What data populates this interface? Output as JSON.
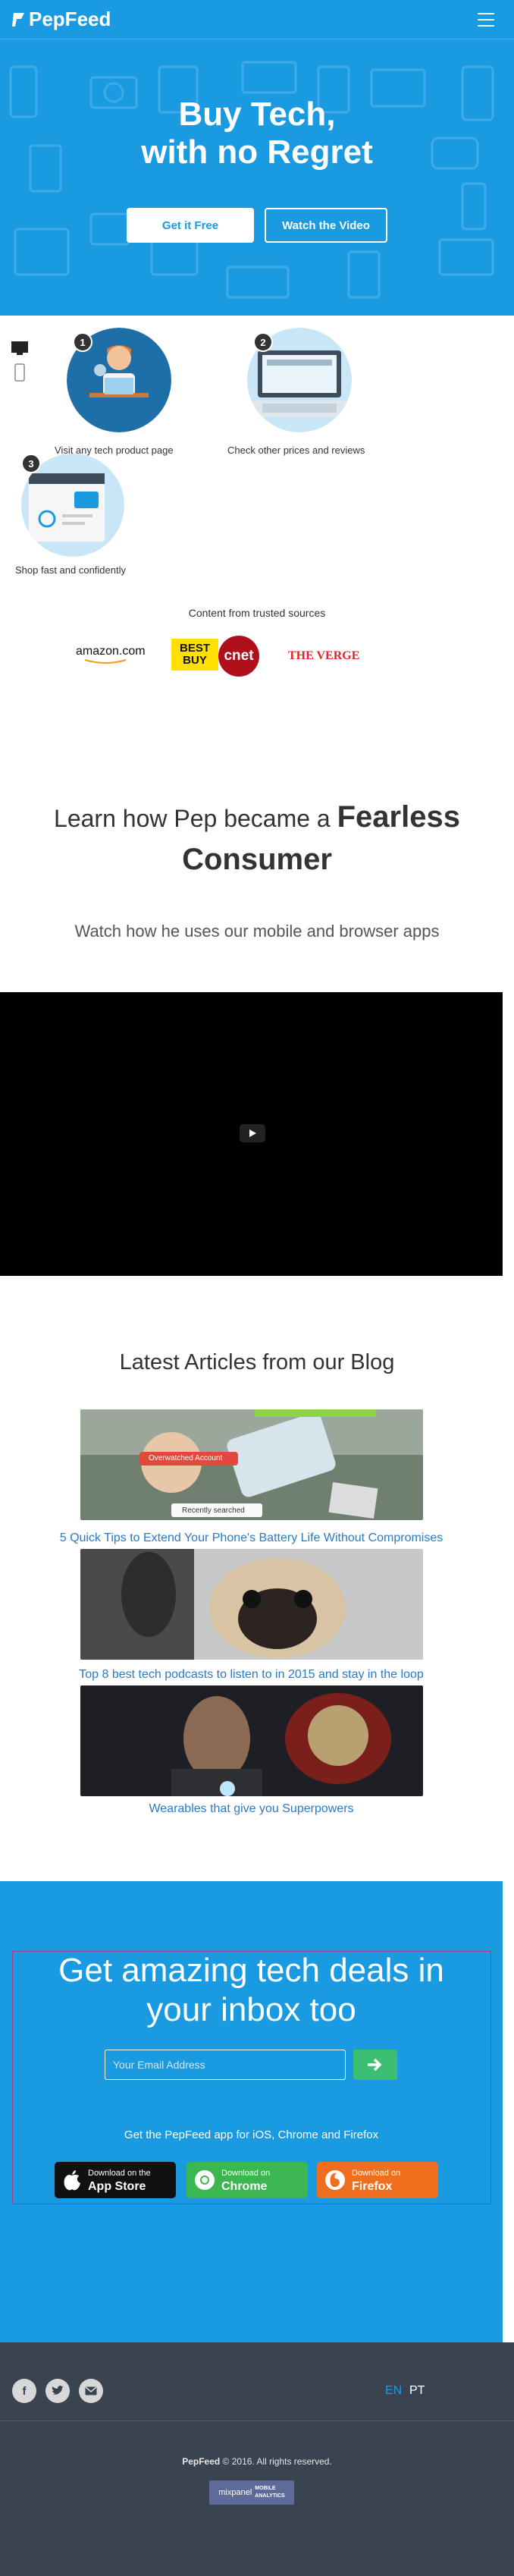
{
  "header": {
    "logo_text": "PepFeed",
    "menu_icon": "hamburger-icon"
  },
  "hero": {
    "title_line1": "Buy Tech,",
    "title_line2": "with no Regret",
    "get_free_label": "Get it Free",
    "watch_video_label": "Watch the Video"
  },
  "steps": [
    {
      "number": "1",
      "label": "Visit any tech product page"
    },
    {
      "number": "2",
      "label": "Check other prices and reviews"
    },
    {
      "number": "3",
      "label": "Shop fast and confidently"
    }
  ],
  "sources": {
    "title": "Content from trusted sources",
    "brands": [
      "amazon.com",
      "BEST BUY",
      "cnet",
      "THE VERGE"
    ]
  },
  "learn": {
    "title_prefix": "Learn how Pep became a",
    "title_bold": "Fearless Consumer",
    "subtitle": "Watch how he uses our mobile and browser apps"
  },
  "blog": {
    "title": "Latest Articles from our Blog",
    "posts": [
      {
        "title": "5 Quick Tips to Extend Your Phone's Battery Life Without Compromises",
        "image_tags": [
          "Recently searched",
          "Overwatched Account"
        ]
      },
      {
        "title": "Top 8 best tech podcasts to listen to in 2015 and stay in the loop"
      },
      {
        "title": "Wearables that give you Superpowers"
      }
    ]
  },
  "newsletter": {
    "title_line1": "Get amazing tech deals in",
    "title_line2": "your inbox too",
    "email_placeholder": "Your Email Address",
    "submit_icon": "arrow-right-icon",
    "apps_text": "Get the PepFeed app for iOS, Chrome and Firefox",
    "stores": [
      {
        "small": "Download on the",
        "big": "App Store",
        "color": "#111111"
      },
      {
        "small": "Download on",
        "big": "Chrome",
        "color": "#3cb650"
      },
      {
        "small": "Download on",
        "big": "Firefox",
        "color": "#f06f1f"
      }
    ]
  },
  "footer": {
    "languages": [
      "EN",
      "PT"
    ],
    "active_language": "EN",
    "copyright_brand": "PepFeed",
    "copyright_text": "© 2016. All rights reserved.",
    "badge_brand": "mixpanel",
    "badge_text_line1": "MOBILE",
    "badge_text_line2": "ANALYTICS"
  },
  "colors": {
    "brand_blue": "#1a9ae0",
    "footer_bg": "#3a4350",
    "cta_green": "#3cbf72",
    "link_blue": "#2a7ac6"
  }
}
